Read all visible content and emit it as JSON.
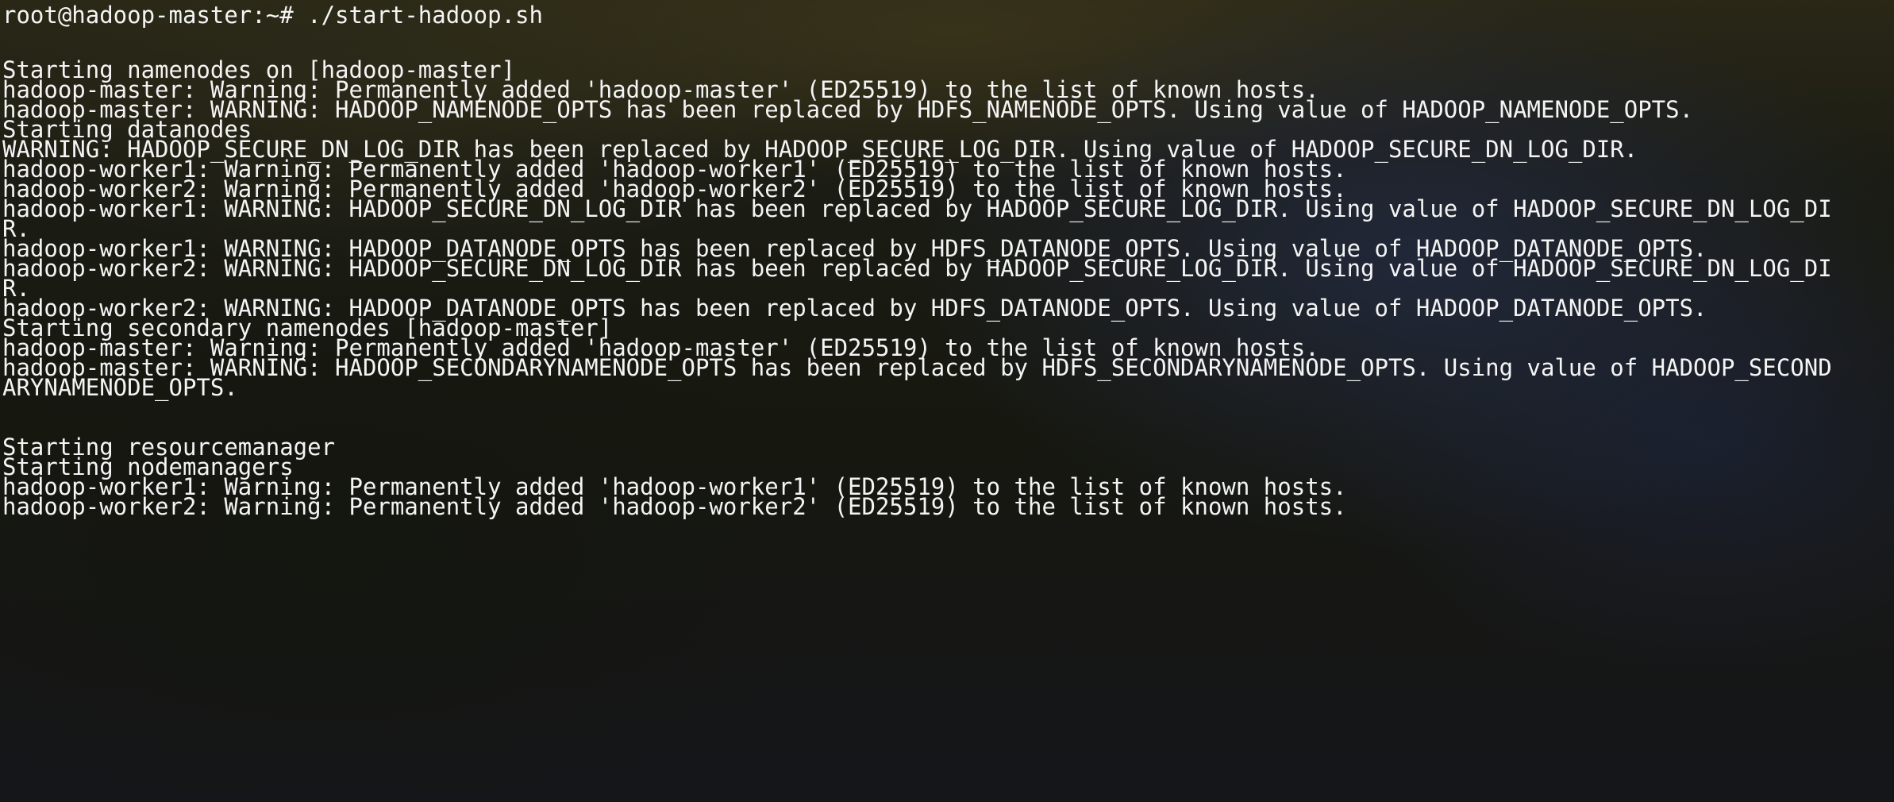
{
  "terminal": {
    "prompt": "root@hadoop-master:~# ./start-hadoop.sh",
    "lines": [
      "Starting namenodes on [hadoop-master]",
      "hadoop-master: Warning: Permanently added 'hadoop-master' (ED25519) to the list of known hosts.",
      "hadoop-master: WARNING: HADOOP_NAMENODE_OPTS has been replaced by HDFS_NAMENODE_OPTS. Using value of HADOOP_NAMENODE_OPTS.",
      "Starting datanodes",
      "WARNING: HADOOP_SECURE_DN_LOG_DIR has been replaced by HADOOP_SECURE_LOG_DIR. Using value of HADOOP_SECURE_DN_LOG_DIR.",
      "hadoop-worker1: Warning: Permanently added 'hadoop-worker1' (ED25519) to the list of known hosts.",
      "hadoop-worker2: Warning: Permanently added 'hadoop-worker2' (ED25519) to the list of known hosts.",
      "hadoop-worker1: WARNING: HADOOP_SECURE_DN_LOG_DIR has been replaced by HADOOP_SECURE_LOG_DIR. Using value of HADOOP_SECURE_DN_LOG_DI",
      "R.",
      "hadoop-worker1: WARNING: HADOOP_DATANODE_OPTS has been replaced by HDFS_DATANODE_OPTS. Using value of HADOOP_DATANODE_OPTS.",
      "hadoop-worker2: WARNING: HADOOP_SECURE_DN_LOG_DIR has been replaced by HADOOP_SECURE_LOG_DIR. Using value of HADOOP_SECURE_DN_LOG_DI",
      "R.",
      "hadoop-worker2: WARNING: HADOOP_DATANODE_OPTS has been replaced by HDFS_DATANODE_OPTS. Using value of HADOOP_DATANODE_OPTS.",
      "Starting secondary namenodes [hadoop-master]",
      "hadoop-master: Warning: Permanently added 'hadoop-master' (ED25519) to the list of known hosts.",
      "hadoop-master: WARNING: HADOOP_SECONDARYNAMENODE_OPTS has been replaced by HDFS_SECONDARYNAMENODE_OPTS. Using value of HADOOP_SECOND",
      "ARYNAMENODE_OPTS.",
      "",
      "",
      "Starting resourcemanager",
      "Starting nodemanagers",
      "hadoop-worker1: Warning: Permanently added 'hadoop-worker1' (ED25519) to the list of known hosts.",
      "hadoop-worker2: Warning: Permanently added 'hadoop-worker2' (ED25519) to the list of known hosts."
    ]
  },
  "colors": {
    "text": "#f4f4f4"
  }
}
